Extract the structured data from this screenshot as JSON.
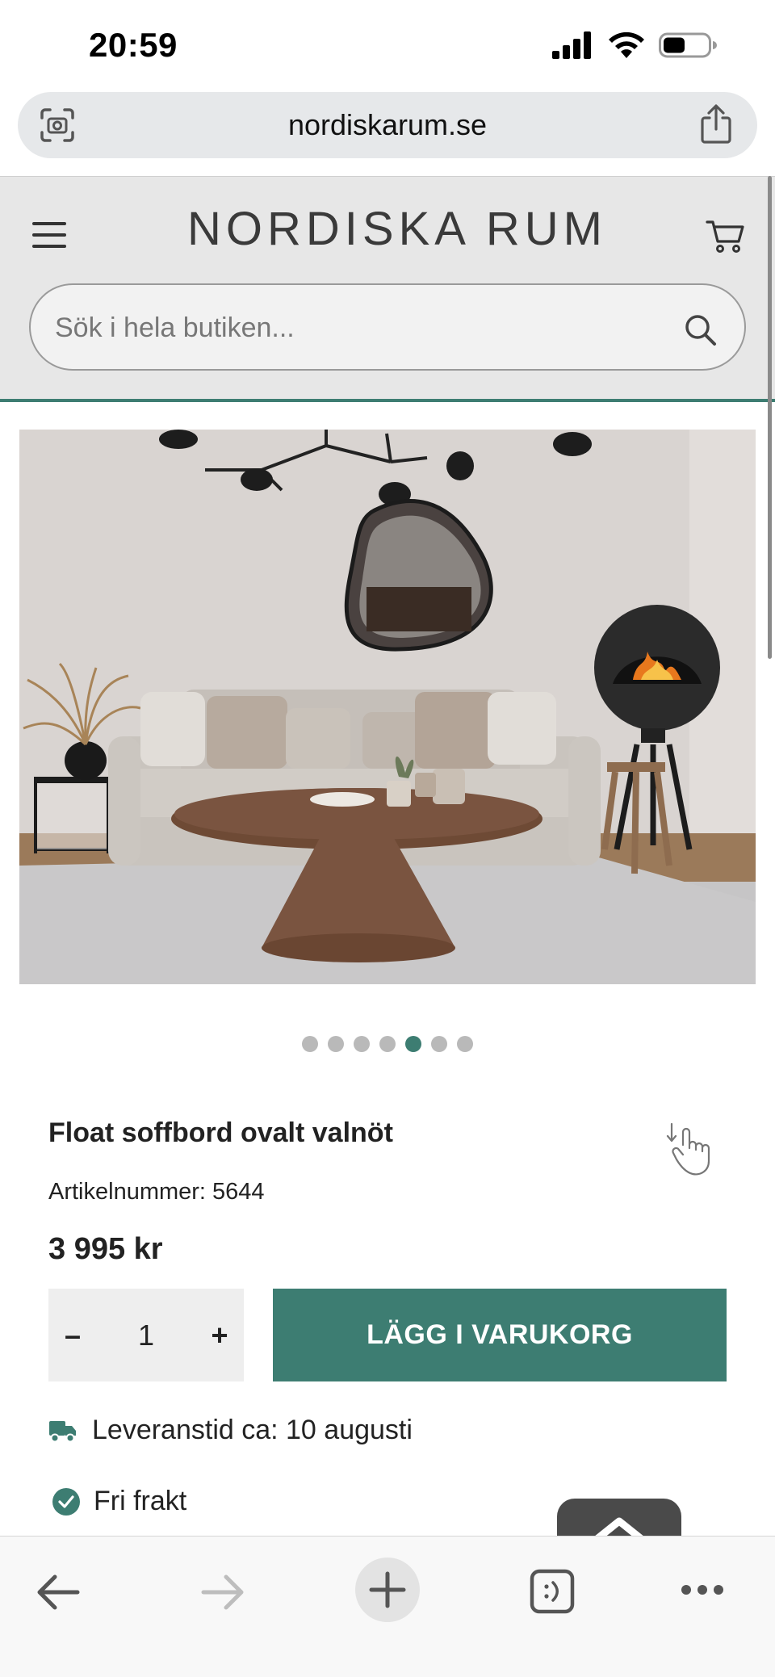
{
  "status_bar": {
    "time": "20:59"
  },
  "browser": {
    "url": "nordiskarum.se"
  },
  "site": {
    "logo": "NORDISKA RUM",
    "search_placeholder": "Sök i hela butiken..."
  },
  "carousel": {
    "total": 7,
    "active_index": 4
  },
  "product": {
    "title": "Float soffbord ovalt valnöt",
    "sku": "Artikelnummer: 5644",
    "price": "3 995 kr",
    "quantity": "1",
    "minus_label": "–",
    "plus_label": "+",
    "add_to_cart_label": "LÄGG I VARUKORG",
    "delivery_text": "Leveranstid ca: 10 augusti",
    "free_shipping_text": "Fri frakt"
  },
  "colors": {
    "accent": "#3d7d72",
    "header_bg": "#e7e7e7"
  },
  "icons": {
    "status": [
      "signal-icon",
      "wifi-icon",
      "battery-icon"
    ],
    "browser": [
      "screenshot-icon",
      "share-icon"
    ],
    "toolbar": [
      "back-arrow-icon",
      "forward-arrow-icon",
      "new-tab-plus-icon",
      "tabs-icon",
      "more-icon"
    ]
  }
}
